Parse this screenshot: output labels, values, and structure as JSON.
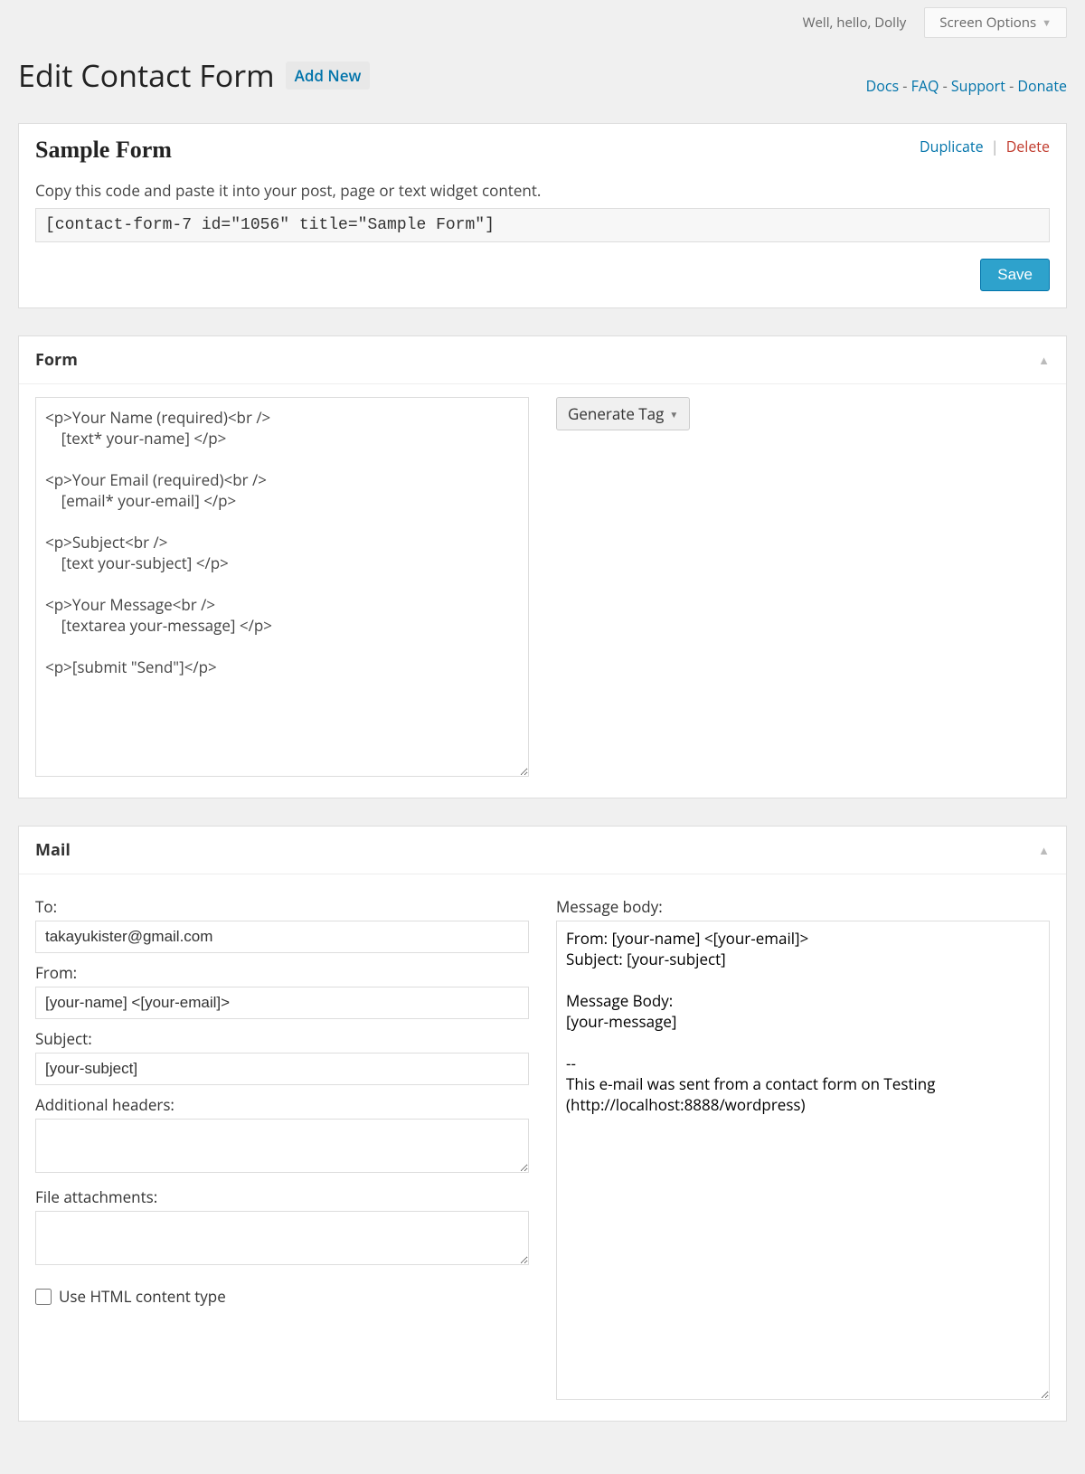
{
  "top": {
    "greeting": "Well, hello, Dolly",
    "screen_options": "Screen Options"
  },
  "header": {
    "title": "Edit Contact Form",
    "add_new": "Add New",
    "links": {
      "docs": "Docs",
      "faq": "FAQ",
      "support": "Support",
      "donate": "Donate"
    }
  },
  "main": {
    "form_title": "Sample Form",
    "duplicate": "Duplicate",
    "delete": "Delete",
    "hint": "Copy this code and paste it into your post, page or text widget content.",
    "shortcode": "[contact-form-7 id=\"1056\" title=\"Sample Form\"]",
    "save": "Save"
  },
  "form_panel": {
    "title": "Form",
    "code": "<p>Your Name (required)<br />\n    [text* your-name] </p>\n\n<p>Your Email (required)<br />\n    [email* your-email] </p>\n\n<p>Subject<br />\n    [text your-subject] </p>\n\n<p>Your Message<br />\n    [textarea your-message] </p>\n\n<p>[submit \"Send\"]</p>",
    "generate_tag": "Generate Tag"
  },
  "mail_panel": {
    "title": "Mail",
    "to_label": "To:",
    "to_value": "takayukister@gmail.com",
    "from_label": "From:",
    "from_value": "[your-name] <[your-email]>",
    "subject_label": "Subject:",
    "subject_value": "[your-subject]",
    "headers_label": "Additional headers:",
    "headers_value": "",
    "attachments_label": "File attachments:",
    "attachments_value": "",
    "html_check": "Use HTML content type",
    "body_label": "Message body:",
    "body_value": "From: [your-name] <[your-email]>\nSubject: [your-subject]\n\nMessage Body:\n[your-message]\n\n--\nThis e-mail was sent from a contact form on Testing (http://localhost:8888/wordpress)"
  }
}
